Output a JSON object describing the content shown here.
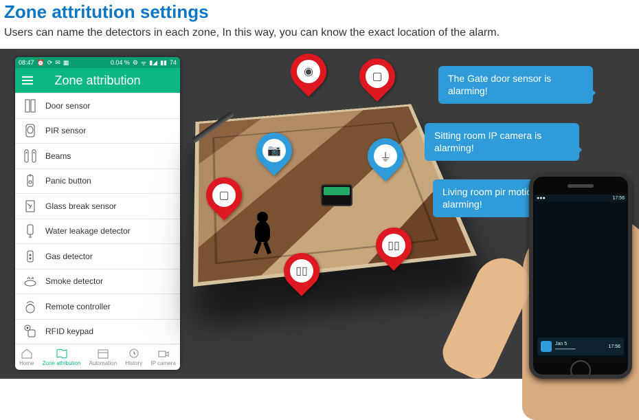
{
  "header": {
    "title": "Zone attritution settings",
    "subtitle": "Users can name the detectors in each zone, In this way, you can know the exact location of the alarm."
  },
  "statusbar": {
    "time": "08:47",
    "pct": "0.04 %",
    "batt": "74"
  },
  "appbar": {
    "title": "Zone attribution"
  },
  "zones": [
    {
      "label": "Door sensor",
      "icon": "door"
    },
    {
      "label": "PIR sensor",
      "icon": "pir"
    },
    {
      "label": "Beams",
      "icon": "beams"
    },
    {
      "label": "Panic button",
      "icon": "panic"
    },
    {
      "label": "Glass break sensor",
      "icon": "glass"
    },
    {
      "label": "Water leakage detector",
      "icon": "water"
    },
    {
      "label": "Gas detector",
      "icon": "gas"
    },
    {
      "label": "Smoke detector",
      "icon": "smoke"
    },
    {
      "label": "Remote controller",
      "icon": "remote"
    },
    {
      "label": "RFID keypad",
      "icon": "rfid"
    }
  ],
  "tabs": [
    {
      "label": "Home"
    },
    {
      "label": "Zone attribution"
    },
    {
      "label": "Automation"
    },
    {
      "label": "History"
    },
    {
      "label": "IP camera"
    }
  ],
  "bubbles": [
    "The Gate door sensor is alarming!",
    "Sitting room IP camera is alarming!",
    "Living room pir motion detector is alarming!"
  ],
  "phone_r": {
    "time": "17:56",
    "date": "Jan 5"
  }
}
